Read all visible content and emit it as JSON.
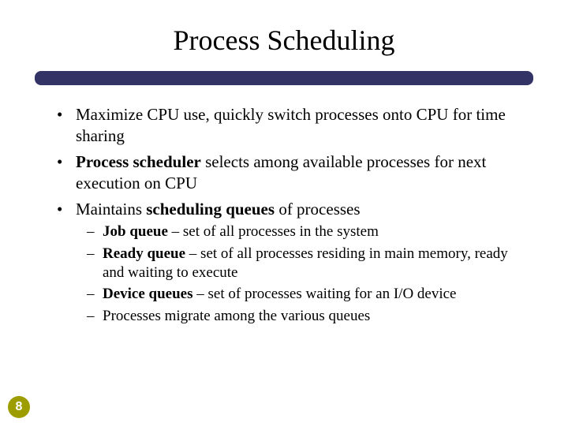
{
  "title": "Process Scheduling",
  "page_number": "8",
  "bullets": {
    "b1_pre": "Maximize CPU use, quickly switch processes onto CPU for time sharing",
    "b2_bold": "Process scheduler",
    "b2_rest": " selects among available processes for next execution on CPU",
    "b3_pre": "Maintains ",
    "b3_bold": "scheduling queues ",
    "b3_rest": "of processes",
    "sub": {
      "s1_bold": "Job queue",
      "s1_rest": " – set of all processes in the system",
      "s2_bold": "Ready queue",
      "s2_rest": " – set of all processes residing in main memory, ready and waiting to execute",
      "s3_bold": "Device queues",
      "s3_rest": " – set of processes waiting for an I/O device",
      "s4": "Processes migrate among the various queues"
    }
  }
}
